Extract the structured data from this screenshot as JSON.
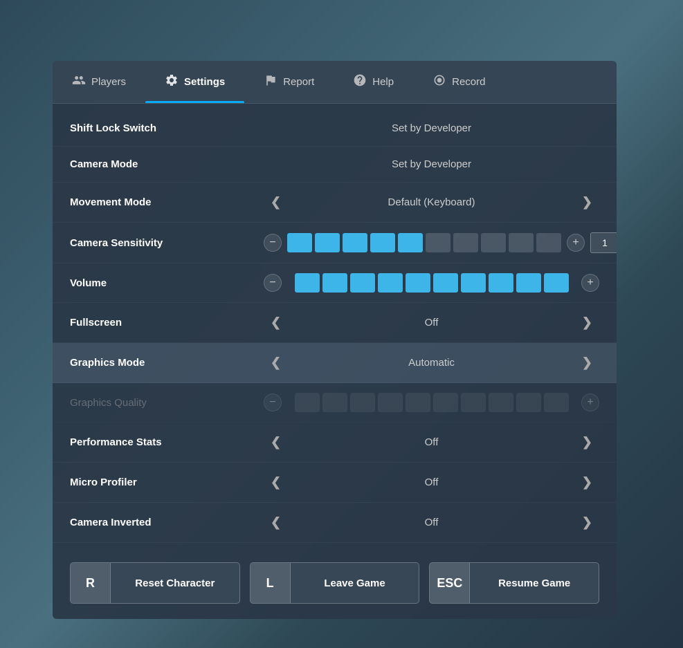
{
  "background": {
    "color": "#3a5068"
  },
  "panel": {
    "tabs": [
      {
        "id": "players",
        "label": "Players",
        "icon": "👤",
        "active": false
      },
      {
        "id": "settings",
        "label": "Settings",
        "icon": "⚙️",
        "active": true
      },
      {
        "id": "report",
        "label": "Report",
        "icon": "🚩",
        "active": false
      },
      {
        "id": "help",
        "label": "Help",
        "icon": "❓",
        "active": false
      },
      {
        "id": "record",
        "label": "Record",
        "icon": "⏺",
        "active": false
      }
    ],
    "settings": [
      {
        "id": "shift-lock-switch",
        "label": "Shift Lock Switch",
        "type": "static",
        "value": "Set by Developer",
        "highlighted": false,
        "disabled": false
      },
      {
        "id": "camera-mode",
        "label": "Camera Mode",
        "type": "static",
        "value": "Set by Developer",
        "highlighted": false,
        "disabled": false
      },
      {
        "id": "movement-mode",
        "label": "Movement Mode",
        "type": "arrow",
        "value": "Default (Keyboard)",
        "highlighted": false,
        "disabled": false
      },
      {
        "id": "camera-sensitivity",
        "label": "Camera Sensitivity",
        "type": "slider",
        "filledBlocks": 5,
        "totalBlocks": 10,
        "inputValue": "1",
        "highlighted": false,
        "disabled": false,
        "hasInput": true
      },
      {
        "id": "volume",
        "label": "Volume",
        "type": "slider",
        "filledBlocks": 10,
        "totalBlocks": 10,
        "inputValue": "",
        "highlighted": false,
        "disabled": false,
        "hasInput": false
      },
      {
        "id": "fullscreen",
        "label": "Fullscreen",
        "type": "arrow",
        "value": "Off",
        "highlighted": false,
        "disabled": false
      },
      {
        "id": "graphics-mode",
        "label": "Graphics Mode",
        "type": "arrow",
        "value": "Automatic",
        "highlighted": true,
        "disabled": false
      },
      {
        "id": "graphics-quality",
        "label": "Graphics Quality",
        "type": "slider-disabled",
        "filledBlocks": 0,
        "totalBlocks": 10,
        "highlighted": false,
        "disabled": true,
        "hasInput": false
      },
      {
        "id": "performance-stats",
        "label": "Performance Stats",
        "type": "arrow",
        "value": "Off",
        "highlighted": false,
        "disabled": false
      },
      {
        "id": "micro-profiler",
        "label": "Micro Profiler",
        "type": "arrow",
        "value": "Off",
        "highlighted": false,
        "disabled": false
      },
      {
        "id": "camera-inverted",
        "label": "Camera Inverted",
        "type": "arrow",
        "value": "Off",
        "highlighted": false,
        "disabled": false
      }
    ],
    "buttons": [
      {
        "id": "reset-character",
        "key": "R",
        "label": "Reset Character"
      },
      {
        "id": "leave-game",
        "key": "L",
        "label": "Leave Game"
      },
      {
        "id": "resume-game",
        "key": "ESC",
        "label": "Resume Game"
      }
    ]
  }
}
